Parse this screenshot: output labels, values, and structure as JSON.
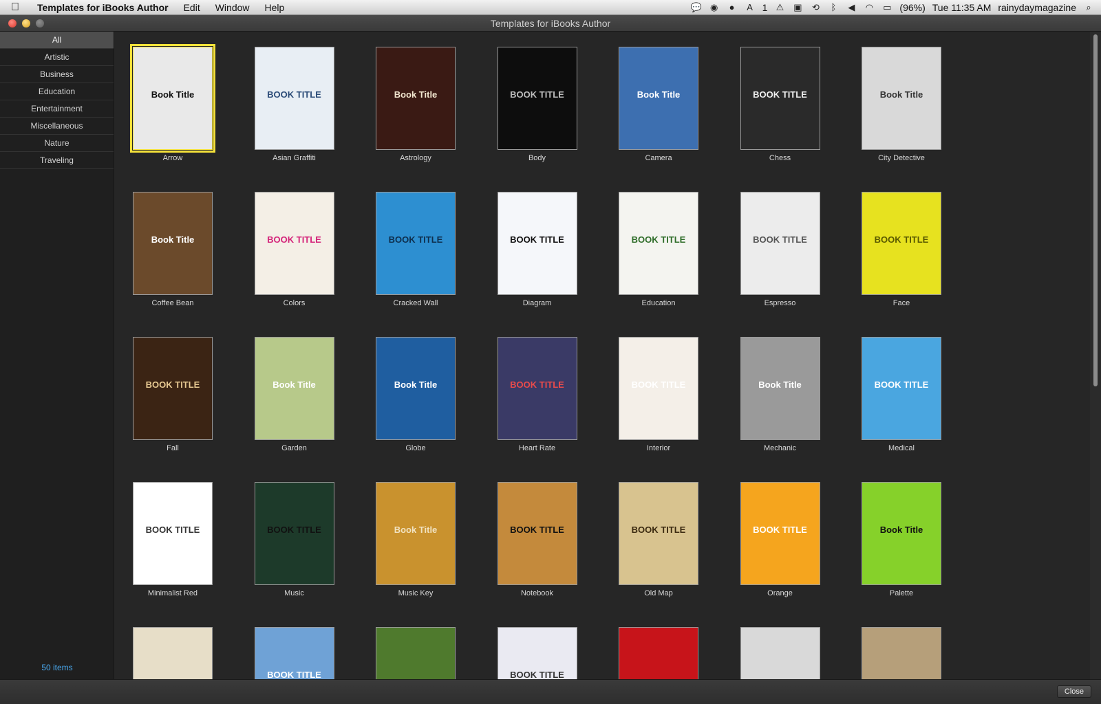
{
  "menubar": {
    "app_name": "Templates for iBooks Author",
    "menus": [
      "Edit",
      "Window",
      "Help"
    ],
    "status": {
      "notifications_count": "1",
      "battery": "(96%)",
      "clock": "Tue 11:35 AM",
      "user": "rainydaymagazine"
    }
  },
  "window": {
    "title": "Templates for iBooks Author"
  },
  "sidebar": {
    "categories": [
      "All",
      "Artistic",
      "Business",
      "Education",
      "Entertainment",
      "Miscellaneous",
      "Nature",
      "Traveling"
    ],
    "selected": "All",
    "count_label": "50 items"
  },
  "templates": [
    {
      "name": "Arrow",
      "cover_text": "Book Title",
      "bg": "#e9e9e9",
      "fg": "#111111",
      "selected": true
    },
    {
      "name": "Asian Graffiti",
      "cover_text": "BOOK TITLE",
      "bg": "#e8eef4",
      "fg": "#2c4c78"
    },
    {
      "name": "Astrology",
      "cover_text": "Book Title",
      "bg": "#3a1a14",
      "fg": "#f2e7d0"
    },
    {
      "name": "Body",
      "cover_text": "BOOK TITLE",
      "bg": "#0d0d0d",
      "fg": "#bdbdbd"
    },
    {
      "name": "Camera",
      "cover_text": "Book Title",
      "bg": "#3d6fb0",
      "fg": "#ffffff"
    },
    {
      "name": "Chess",
      "cover_text": "BOOK TITLE",
      "bg": "#2a2a2a",
      "fg": "#efefef"
    },
    {
      "name": "City Detective",
      "cover_text": "Book Title",
      "bg": "#d9d9d9",
      "fg": "#333333"
    },
    {
      "name": "Coffee Bean",
      "cover_text": "Book Title",
      "bg": "#6b4a2b",
      "fg": "#ffffff"
    },
    {
      "name": "Colors",
      "cover_text": "BOOK TITLE",
      "bg": "#f4efe6",
      "fg": "#d4247a"
    },
    {
      "name": "Cracked Wall",
      "cover_text": "BOOK TITLE",
      "bg": "#2d8fd1",
      "fg": "#0e2f4e"
    },
    {
      "name": "Diagram",
      "cover_text": "BOOK TITLE",
      "bg": "#f5f7fa",
      "fg": "#111111"
    },
    {
      "name": "Education",
      "cover_text": "BOOK TITLE",
      "bg": "#f4f4f0",
      "fg": "#2f6d2a"
    },
    {
      "name": "Espresso",
      "cover_text": "BOOK TITLE",
      "bg": "#ececec",
      "fg": "#555555"
    },
    {
      "name": "Face",
      "cover_text": "BOOK TITLE",
      "bg": "#e7e21f",
      "fg": "#5a5a00"
    },
    {
      "name": "Fall",
      "cover_text": "BOOK TITLE",
      "bg": "#3b2414",
      "fg": "#e6c891"
    },
    {
      "name": "Garden",
      "cover_text": "Book Title",
      "bg": "#b7c98a",
      "fg": "#ffffff"
    },
    {
      "name": "Globe",
      "cover_text": "Book Title",
      "bg": "#1f5ea0",
      "fg": "#ffffff"
    },
    {
      "name": "Heart Rate",
      "cover_text": "BOOK TITLE",
      "bg": "#3a3a66",
      "fg": "#e94b4b"
    },
    {
      "name": "Interior",
      "cover_text": "BOOK TITLE",
      "bg": "#f4efe8",
      "fg": "#ffffff"
    },
    {
      "name": "Mechanic",
      "cover_text": "Book Title",
      "bg": "#9a9a9a",
      "fg": "#ffffff"
    },
    {
      "name": "Medical",
      "cover_text": "BOOK TITLE",
      "bg": "#4aa6e0",
      "fg": "#ffffff"
    },
    {
      "name": "Minimalist Red",
      "cover_text": "BOOK TITLE",
      "bg": "#ffffff",
      "fg": "#333333"
    },
    {
      "name": "Music",
      "cover_text": "BOOK TITLE",
      "bg": "#1d3a2a",
      "fg": "#111111"
    },
    {
      "name": "Music Key",
      "cover_text": "Book Title",
      "bg": "#c9922e",
      "fg": "#f1e2c0"
    },
    {
      "name": "Notebook",
      "cover_text": "BOOK TITLE",
      "bg": "#c48a3c",
      "fg": "#111111"
    },
    {
      "name": "Old Map",
      "cover_text": "BOOK TITLE",
      "bg": "#d8c38f",
      "fg": "#3b2a10"
    },
    {
      "name": "Orange",
      "cover_text": "BOOK TITLE",
      "bg": "#f5a51e",
      "fg": "#ffffff"
    },
    {
      "name": "Palette",
      "cover_text": "Book Title",
      "bg": "#86d12a",
      "fg": "#111111"
    },
    {
      "name": "",
      "cover_text": "",
      "bg": "#e7dec8",
      "fg": "#333333"
    },
    {
      "name": "",
      "cover_text": "BOOK TITLE",
      "bg": "#6fa2d6",
      "fg": "#ffffff"
    },
    {
      "name": "",
      "cover_text": "",
      "bg": "#4f7a2d",
      "fg": "#ffffff"
    },
    {
      "name": "",
      "cover_text": "BOOK TITLE",
      "bg": "#eaeaf2",
      "fg": "#333333"
    },
    {
      "name": "",
      "cover_text": "",
      "bg": "#c7141a",
      "fg": "#ffffff"
    },
    {
      "name": "",
      "cover_text": "",
      "bg": "#d9d9d9",
      "fg": "#333333"
    },
    {
      "name": "",
      "cover_text": "",
      "bg": "#b69f7a",
      "fg": "#333333"
    }
  ],
  "footer": {
    "close_label": "Close"
  }
}
